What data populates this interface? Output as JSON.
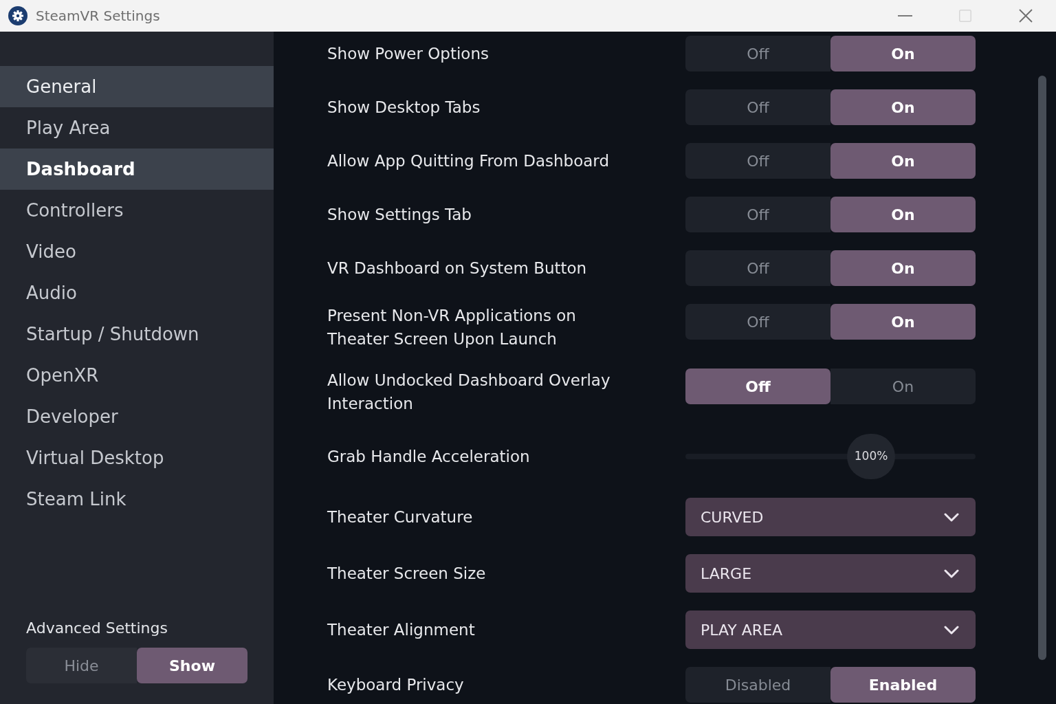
{
  "window": {
    "title": "SteamVR Settings",
    "maximize_disabled": true
  },
  "sidebar": {
    "items": [
      {
        "label": "General",
        "selected": false,
        "highlighted": true
      },
      {
        "label": "Play Area",
        "selected": false,
        "highlighted": false
      },
      {
        "label": "Dashboard",
        "selected": true,
        "highlighted": false
      },
      {
        "label": "Controllers",
        "selected": false,
        "highlighted": false
      },
      {
        "label": "Video",
        "selected": false,
        "highlighted": false
      },
      {
        "label": "Audio",
        "selected": false,
        "highlighted": false
      },
      {
        "label": "Startup / Shutdown",
        "selected": false,
        "highlighted": false
      },
      {
        "label": "OpenXR",
        "selected": false,
        "highlighted": false
      },
      {
        "label": "Developer",
        "selected": false,
        "highlighted": false
      },
      {
        "label": "Virtual Desktop",
        "selected": false,
        "highlighted": false
      },
      {
        "label": "Steam Link",
        "selected": false,
        "highlighted": false
      }
    ],
    "advanced_settings": {
      "label": "Advanced Settings",
      "options": [
        {
          "label": "Hide",
          "selected": false
        },
        {
          "label": "Show",
          "selected": true
        }
      ]
    }
  },
  "settings": [
    {
      "kind": "toggle",
      "label": "Show Power Options",
      "options": [
        {
          "label": "Off",
          "selected": false
        },
        {
          "label": "On",
          "selected": true
        }
      ]
    },
    {
      "kind": "toggle",
      "label": "Show Desktop Tabs",
      "options": [
        {
          "label": "Off",
          "selected": false
        },
        {
          "label": "On",
          "selected": true
        }
      ]
    },
    {
      "kind": "toggle",
      "label": "Allow App Quitting From Dashboard",
      "options": [
        {
          "label": "Off",
          "selected": false
        },
        {
          "label": "On",
          "selected": true
        }
      ]
    },
    {
      "kind": "toggle",
      "label": "Show Settings Tab",
      "options": [
        {
          "label": "Off",
          "selected": false
        },
        {
          "label": "On",
          "selected": true
        }
      ]
    },
    {
      "kind": "toggle",
      "label": "VR Dashboard on System Button",
      "options": [
        {
          "label": "Off",
          "selected": false
        },
        {
          "label": "On",
          "selected": true
        }
      ]
    },
    {
      "kind": "toggle",
      "label": "Present Non-VR Applications on Theater Screen Upon Launch",
      "options": [
        {
          "label": "Off",
          "selected": false
        },
        {
          "label": "On",
          "selected": true
        }
      ]
    },
    {
      "kind": "toggle",
      "label": "Allow Undocked Dashboard Overlay Interaction",
      "options": [
        {
          "label": "Off",
          "selected": true
        },
        {
          "label": "On",
          "selected": false
        }
      ]
    },
    {
      "kind": "slider",
      "label": "Grab Handle Acceleration",
      "level": 0.64,
      "reading": "100%"
    },
    {
      "kind": "dropdown",
      "label": "Theater Curvature",
      "value": "CURVED"
    },
    {
      "kind": "dropdown",
      "label": "Theater Screen Size",
      "value": "LARGE"
    },
    {
      "kind": "dropdown",
      "label": "Theater Alignment",
      "value": "PLAY AREA"
    },
    {
      "kind": "toggle",
      "label": "Keyboard Privacy",
      "options": [
        {
          "label": "Disabled",
          "selected": false
        },
        {
          "label": "Enabled",
          "selected": true
        }
      ]
    }
  ]
}
